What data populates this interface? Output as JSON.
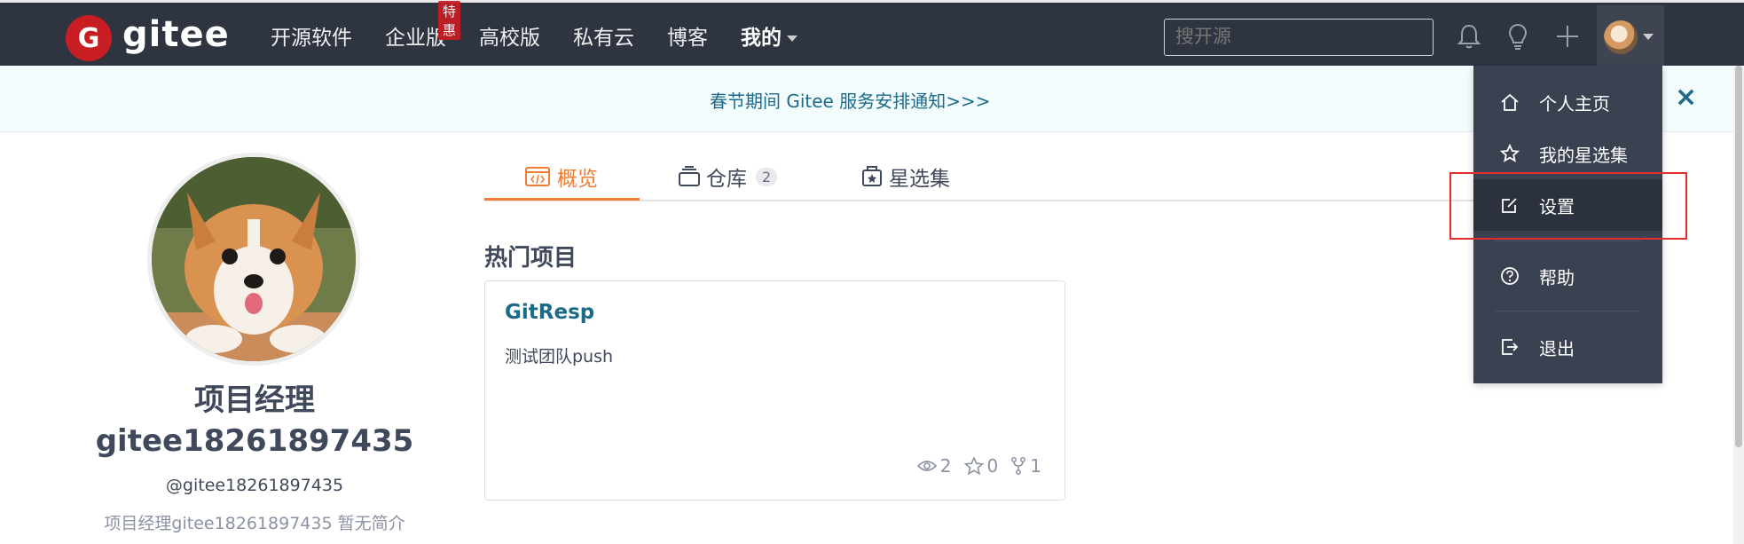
{
  "nav": {
    "logo_text": "gitee",
    "links": [
      {
        "label": "开源软件"
      },
      {
        "label": "企业版",
        "badge": "特惠"
      },
      {
        "label": "高校版"
      },
      {
        "label": "私有云"
      },
      {
        "label": "博客"
      },
      {
        "label": "我的"
      }
    ],
    "search_placeholder": "搜开源",
    "icons": [
      "bell-icon",
      "lightbulb-icon",
      "plus-icon"
    ]
  },
  "banner": {
    "text": "春节期间 Gitee 服务安排通知>>>",
    "close_label": "×"
  },
  "profile": {
    "name": "项目经理gitee18261897435",
    "handle": "@gitee18261897435",
    "bio": "项目经理gitee18261897435 暂无简介"
  },
  "tabs": [
    {
      "label": "概览",
      "active": true
    },
    {
      "label": "仓库",
      "count": "2"
    },
    {
      "label": "星选集"
    }
  ],
  "main": {
    "section_title": "热门项目",
    "project": {
      "name": "GitResp",
      "description": "测试团队push",
      "watch_count": "2",
      "star_count": "0",
      "fork_count": "1"
    }
  },
  "dropdown": {
    "items": [
      {
        "label": "个人主页",
        "icon": "home-icon"
      },
      {
        "label": "我的星选集",
        "icon": "star-icon"
      },
      {
        "label": "设置",
        "icon": "edit-icon",
        "active": true
      },
      {
        "label": "帮助",
        "icon": "help-icon"
      },
      {
        "label": "退出",
        "icon": "logout-icon"
      }
    ]
  },
  "colors": {
    "nav_bg": "#2e3440",
    "brand_red": "#c71d23",
    "accent_orange": "#f07c35",
    "link_blue": "#1c6a8a",
    "highlight_red": "#e12d2d"
  }
}
